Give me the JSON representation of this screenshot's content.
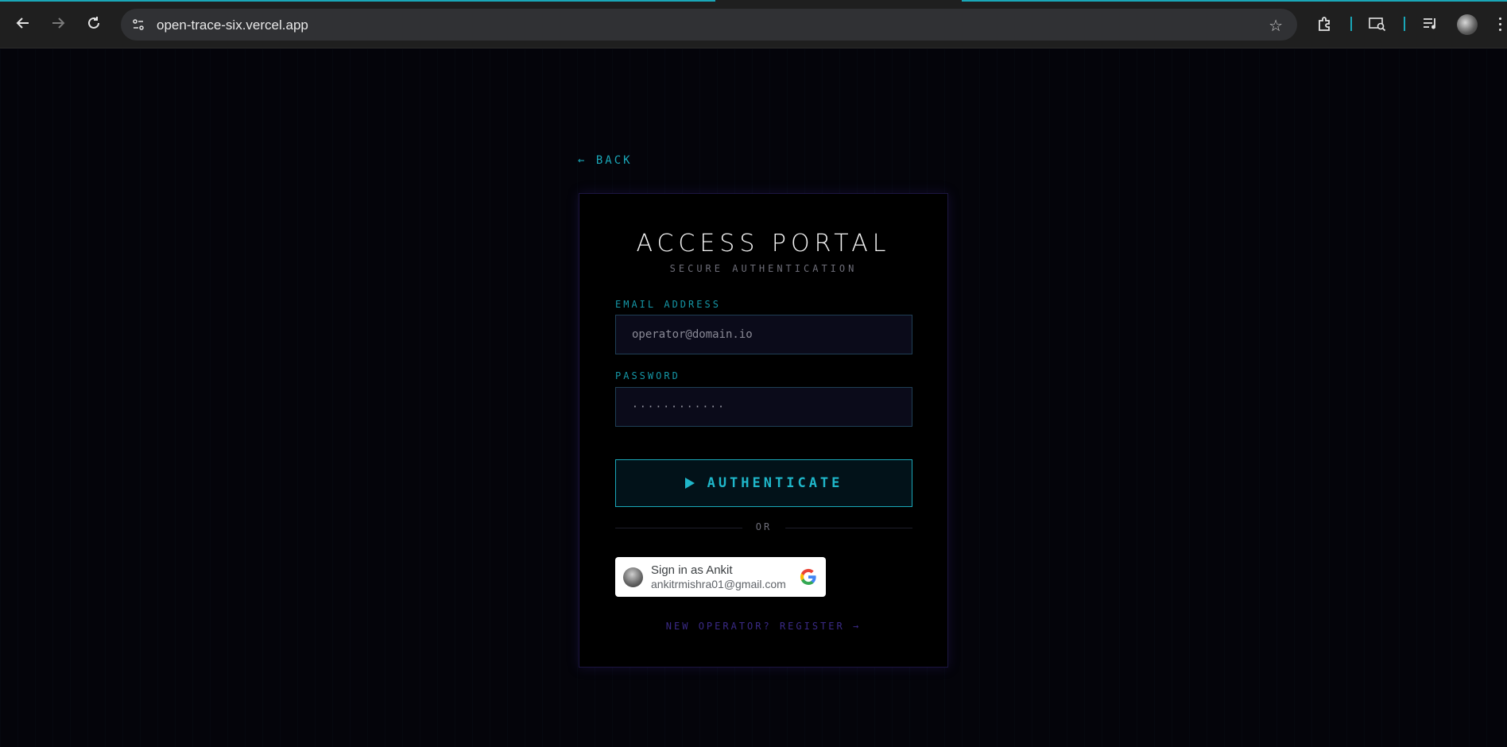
{
  "browser": {
    "url": "open-trace-six.vercel.app",
    "icons": [
      "back-arrow-icon",
      "forward-arrow-icon",
      "reload-icon",
      "site-info-icon",
      "bookmark-star-icon",
      "extensions-icon",
      "search-page-icon",
      "media-control-icon",
      "profile-avatar-icon",
      "menu-kebab-icon"
    ],
    "accent_color": "#1aa7b8"
  },
  "page": {
    "back_label": "← BACK",
    "title": "ACCESS PORTAL",
    "subtitle": "SECURE AUTHENTICATION",
    "email": {
      "label": "EMAIL ADDRESS",
      "placeholder": "operator@domain.io"
    },
    "password": {
      "label": "PASSWORD",
      "value": "············"
    },
    "authenticate_label": "AUTHENTICATE",
    "or_label": "OR",
    "google": {
      "name": "Sign in as Ankit",
      "email": "ankitrmishra01@gmail.com"
    },
    "register_label": "NEW OPERATOR? REGISTER →",
    "colors": {
      "accent": "#1aa7b8",
      "register": "#3a2a86",
      "card_border": "#1c1540"
    }
  }
}
